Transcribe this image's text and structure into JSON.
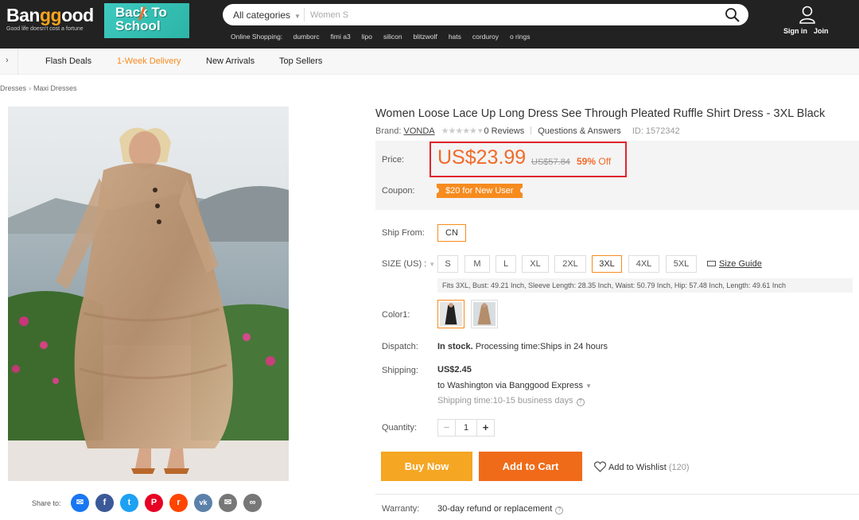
{
  "header": {
    "logo_text_a": "Ban",
    "logo_text_b": "gg",
    "logo_text_c": "ood",
    "tagline": "Good life doesn't cost a fortune",
    "promo_banner": "Back To School",
    "category_select": "All categories",
    "search_placeholder": "Women S",
    "hot_label": "Online Shopping:",
    "hot_searches": [
      "dumborc",
      "fimi a3",
      "lipo",
      "silicon",
      "blitzwolf",
      "hats",
      "corduroy",
      "o rings"
    ],
    "sign_in": "Sign in",
    "join": "Join"
  },
  "nav": {
    "items": [
      "Flash Deals",
      "1-Week Delivery",
      "New Arrivals",
      "Top Sellers"
    ],
    "highlight_color": "#f68b1e"
  },
  "breadcrumb": [
    "Dresses",
    "Maxi Dresses"
  ],
  "share": {
    "label": "Share to:",
    "icons": [
      "messenger-icon",
      "facebook-icon",
      "twitter-icon",
      "pinterest-icon",
      "reddit-icon",
      "vk-icon",
      "email-icon",
      "link-icon"
    ]
  },
  "product": {
    "title": "Women Loose Lace Up Long Dress See Through Pleated Ruffle Shirt Dress - 3XL Black",
    "brand_label": "Brand:",
    "brand": "VONDA",
    "reviews": "0 Reviews",
    "qa": "Questions & Answers",
    "id": "ID: 1572342",
    "price_label": "Price:",
    "price": "US$23.99",
    "old_price": "US$57.84",
    "discount_pct": "59%",
    "discount_word": "Off",
    "coupon_label": "Coupon:",
    "coupon": "$20 for New User",
    "ship_from_label": "Ship From:",
    "ship_from": "CN",
    "size_label": "SIZE (US) :",
    "sizes": [
      "S",
      "M",
      "L",
      "XL",
      "2XL",
      "3XL",
      "4XL",
      "5XL"
    ],
    "selected_size": "3XL",
    "size_guide": "Size Guide",
    "fit_info": "Fits 3XL,  Bust: 49.21 Inch,  Sleeve Length: 28.35 Inch,  Waist: 50.79 Inch,  Hip: 57.48 Inch,  Length: 49.61 Inch",
    "color_label": "Color1:",
    "dispatch_label": "Dispatch:",
    "stock": "In stock.",
    "processing": "Processing time:Ships in 24 hours",
    "shipping_label": "Shipping:",
    "shipping_cost": "US$2.45",
    "shipping_to": "to Washington via Banggood Express",
    "shipping_time": "Shipping time:10-15 business days",
    "quantity_label": "Quantity:",
    "quantity": "1",
    "buy_now": "Buy Now",
    "add_to_cart": "Add to Cart",
    "wishlist": "Add to Wishlist",
    "wishlist_count": "(120)",
    "warranty_label": "Warranty:",
    "warranty": "30-day refund or replacement",
    "accent_color": "#f06b2a",
    "highlight_box_color": "#e0252b"
  }
}
